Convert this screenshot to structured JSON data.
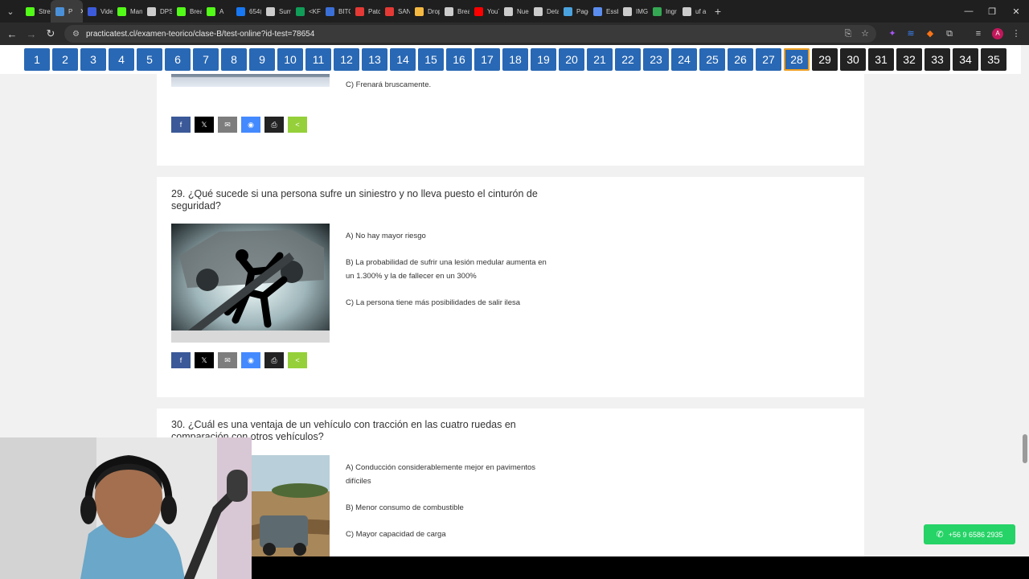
{
  "browser": {
    "tabs": [
      {
        "label": "Strea",
        "color": "#53fc18"
      },
      {
        "label": "P",
        "color": "#4a90d9",
        "active": true
      },
      {
        "label": "Vide",
        "color": "#3b5bdb"
      },
      {
        "label": "Man",
        "color": "#53fc18"
      },
      {
        "label": "DPS",
        "color": "#cccccc"
      },
      {
        "label": "Brea",
        "color": "#53fc18"
      },
      {
        "label": "A",
        "color": "#53fc18"
      },
      {
        "label": "654(",
        "color": "#1877f2"
      },
      {
        "label": "Sum",
        "color": "#cccccc"
      },
      {
        "label": "<KF",
        "color": "#0f9d58"
      },
      {
        "label": "BITO",
        "color": "#3b6fd8"
      },
      {
        "label": "Patc",
        "color": "#e53935"
      },
      {
        "label": "SAN",
        "color": "#e53935"
      },
      {
        "label": "Drop",
        "color": "#f5b942"
      },
      {
        "label": "Brea",
        "color": "#cccccc"
      },
      {
        "label": "YouT",
        "color": "#ff0000"
      },
      {
        "label": "Nue",
        "color": "#cccccc"
      },
      {
        "label": "Deta",
        "color": "#cccccc"
      },
      {
        "label": "Pagc",
        "color": "#4aa3df"
      },
      {
        "label": "Essb",
        "color": "#5b8def"
      },
      {
        "label": "IMG",
        "color": "#cccccc"
      },
      {
        "label": "Ingr",
        "color": "#34a853"
      },
      {
        "label": "uf a",
        "color": "#cccccc"
      }
    ],
    "new_tab": "+",
    "url": "practicatest.cl/examen-teorico/clase-B/test-online?id-test=78654",
    "profile_initial": "A"
  },
  "question_nav": {
    "numbers": [
      "1",
      "2",
      "3",
      "4",
      "5",
      "6",
      "7",
      "8",
      "9",
      "10",
      "11",
      "12",
      "13",
      "14",
      "15",
      "16",
      "17",
      "18",
      "19",
      "20",
      "21",
      "22",
      "23",
      "24",
      "25",
      "26",
      "27",
      "28",
      "29",
      "30",
      "31",
      "32",
      "33",
      "34",
      "35"
    ],
    "current": "28",
    "answered_up_to": 28
  },
  "questions": [
    {
      "id": "q28",
      "options": [
        "C) Frenará bruscamente."
      ]
    },
    {
      "id": "q29",
      "title": "29. ¿Qué sucede si una persona sufre un siniestro y no lleva puesto el cinturón de seguridad?",
      "options": [
        "A) No hay mayor riesgo",
        "B) La probabilidad de sufrir una lesión medular aumenta en un 1.300% y la de fallecer en un 300%",
        "C) La persona tiene más posibilidades de salir ilesa"
      ]
    },
    {
      "id": "q30",
      "title": "30. ¿Cuál es una ventaja de un vehículo con tracción en las cuatro ruedas en comparación con otros vehículos?",
      "options": [
        "A) Conducción considerablemente mejor en pavimentos difíciles",
        "B) Menor consumo de combustible",
        "C) Mayor capacidad de carga"
      ]
    }
  ],
  "share_buttons": [
    {
      "name": "facebook",
      "icon": "f",
      "color": "#3b5998"
    },
    {
      "name": "twitter",
      "icon": "𝕏",
      "color": "#000000"
    },
    {
      "name": "email",
      "icon": "✉",
      "color": "#7d7d7d"
    },
    {
      "name": "messenger",
      "icon": "◉",
      "color": "#448aff"
    },
    {
      "name": "print",
      "icon": "⎙",
      "color": "#222222"
    },
    {
      "name": "share",
      "icon": "<",
      "color": "#95d03a"
    }
  ],
  "whatsapp": {
    "label": "+56 9 6586 2935",
    "color": "#25d366"
  }
}
